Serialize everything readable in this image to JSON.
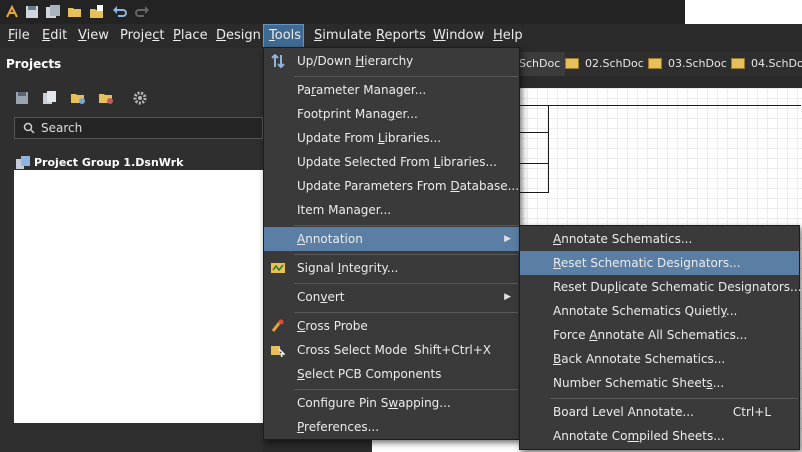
{
  "menubar": {
    "items": [
      {
        "label": "File",
        "u": "F",
        "rest": "ile"
      },
      {
        "label": "Edit",
        "u": "E",
        "rest": "dit"
      },
      {
        "label": "View",
        "u": "V",
        "rest": "iew"
      },
      {
        "label": "Project",
        "pre": "Proje",
        "u": "c",
        "rest": "t"
      },
      {
        "label": "Place",
        "u": "P",
        "rest": "lace"
      },
      {
        "label": "Design",
        "u": "D",
        "rest": "esign"
      },
      {
        "label": "Tools",
        "u": "T",
        "rest": "ools"
      },
      {
        "label": "Simulate",
        "u": "S",
        "rest": "imulate"
      },
      {
        "label": "Reports",
        "u": "R",
        "rest": "eports"
      },
      {
        "label": "Window",
        "u": "W",
        "rest": "indow"
      },
      {
        "label": "Help",
        "u": "H",
        "rest": "elp"
      }
    ]
  },
  "projects": {
    "title": "Projects",
    "search_placeholder": "Search",
    "group_label": "Project Group 1.DsnWrk"
  },
  "doc_tabs": [
    {
      "label": "SchDoc"
    },
    {
      "label": "02.SchDoc"
    },
    {
      "label": "03.SchDoc"
    },
    {
      "label": "04.SchDoc"
    }
  ],
  "tools_menu": {
    "items": [
      {
        "pre": "Up/Down ",
        "u": "H",
        "rest": "ierarchy"
      },
      {
        "pre": "Pa",
        "u": "r",
        "rest": "ameter Manager..."
      },
      {
        "pre": "Footprint Mana",
        "u": "g",
        "rest": "er..."
      },
      {
        "pre": "Update From ",
        "u": "L",
        "rest": "ibraries..."
      },
      {
        "pre": "Update Selected From ",
        "u": "L",
        "rest": "ibraries..."
      },
      {
        "pre": "Update Parameters From ",
        "u": "D",
        "rest": "atabase..."
      },
      {
        "pre": "Item Manager...",
        "u": "",
        "rest": ""
      },
      {
        "pre": "",
        "u": "A",
        "rest": "nnotation"
      },
      {
        "pre": "Signal ",
        "u": "I",
        "rest": "ntegrity..."
      },
      {
        "pre": "Con",
        "u": "v",
        "rest": "ert"
      },
      {
        "pre": "",
        "u": "C",
        "rest": "ross Probe"
      },
      {
        "pre": "Cross Select Mode",
        "u": "",
        "rest": "",
        "shortcut": "Shift+Ctrl+X"
      },
      {
        "pre": "",
        "u": "S",
        "rest": "elect PCB Components"
      },
      {
        "pre": "Configure Pin S",
        "u": "w",
        "rest": "apping..."
      },
      {
        "pre": "",
        "u": "P",
        "rest": "references..."
      }
    ]
  },
  "annotation_menu": {
    "items": [
      {
        "pre": "",
        "u": "A",
        "rest": "nnotate Schematics..."
      },
      {
        "pre": "",
        "u": "R",
        "rest": "eset Schematic Designators..."
      },
      {
        "pre": "Reset Dup",
        "u": "l",
        "rest": "icate Schematic Designators..."
      },
      {
        "pre": "Annotate Schematics Quietl",
        "u": "y",
        "rest": "..."
      },
      {
        "pre": "Force ",
        "u": "A",
        "rest": "nnotate All Schematics..."
      },
      {
        "pre": "",
        "u": "B",
        "rest": "ack Annotate Schematics..."
      },
      {
        "pre": "Number Schematic Sheet",
        "u": "s",
        "rest": "..."
      },
      {
        "pre": "Board Level Annotate...",
        "u": "",
        "rest": "",
        "shortcut": "Ctrl+L"
      },
      {
        "pre": "Annotate Co",
        "u": "m",
        "rest": "piled Sheets..."
      }
    ]
  }
}
